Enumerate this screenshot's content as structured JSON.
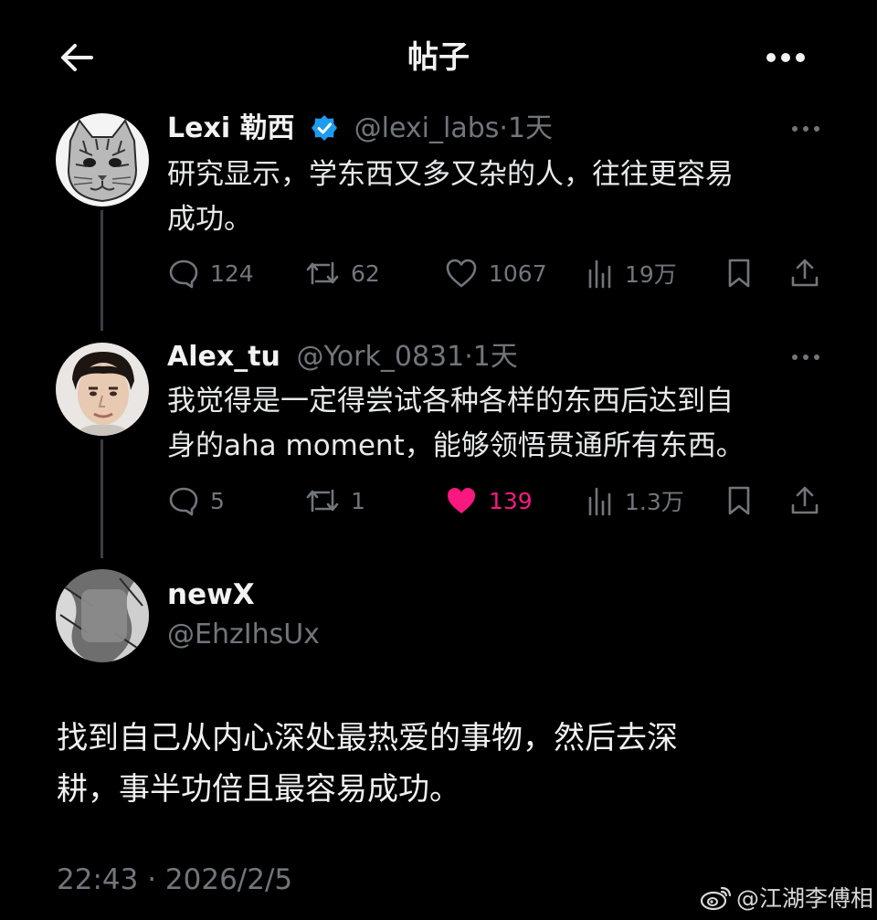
{
  "header": {
    "title": "帖子",
    "back_icon": "arrow-left-icon",
    "more_icon": "more-horizontal-icon"
  },
  "posts": [
    {
      "name": "Lexi 勒西",
      "verified": true,
      "handle": "@lexi_labs",
      "sep": "·",
      "time": "1天",
      "text_lines": [
        "研究显示，学东西又多又杂的人，往往更容易",
        "成功。"
      ],
      "actions": {
        "replies": "124",
        "reposts": "62",
        "likes": "1067",
        "views": "19万"
      }
    },
    {
      "name": "Alex_tu",
      "verified": false,
      "handle": "@York_0831",
      "sep": "·",
      "time": "1天",
      "text_lines": [
        "我觉得是一定得尝试各种各样的东西后达到自",
        "身的aha moment，能够领悟贯通所有东西。"
      ],
      "actions": {
        "replies": "5",
        "reposts": "1",
        "likes": "139",
        "views": "1.3万",
        "liked": true
      }
    }
  ],
  "main_post": {
    "name": "newX",
    "handle": "@EhzIhsUx",
    "text_lines": [
      "找到自己从内心深处最热爱的事物，然后去深",
      "耕，事半功倍且最容易成功。"
    ],
    "timestamp": "22:43 · 2026/2/5"
  },
  "watermark": "@江湖李傅相",
  "colors": {
    "background": "#000000",
    "verified": "#1d9bf0",
    "like_active": "#f91880",
    "muted": "#71767b"
  }
}
